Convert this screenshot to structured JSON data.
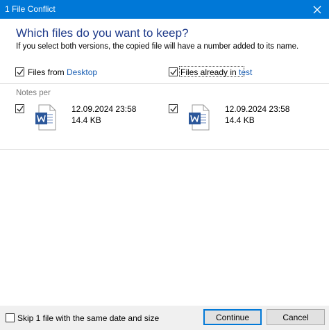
{
  "window": {
    "title": "1 File Conflict",
    "close_icon": "close-icon"
  },
  "header": {
    "heading": "Which files do you want to keep?",
    "subheading": "If you select both versions, the copied file will have a number added to its name."
  },
  "columns": {
    "left": {
      "prefix": "Files from ",
      "source": "Desktop",
      "checked": true
    },
    "right": {
      "prefix": "Files already in ",
      "source": "test",
      "checked": true
    }
  },
  "group": {
    "label": "Notes per"
  },
  "files": [
    {
      "icon": "word-document-icon",
      "date": "12.09.2024 23:58",
      "size": "14.4 KB",
      "checked": true
    },
    {
      "icon": "word-document-icon",
      "date": "12.09.2024 23:58",
      "size": "14.4 KB",
      "checked": true
    }
  ],
  "footer": {
    "skip_label": "Skip 1 file with the same date and size",
    "skip_checked": false,
    "continue_label": "Continue",
    "cancel_label": "Cancel"
  },
  "colors": {
    "accent": "#0078d7",
    "heading": "#1f3b8a",
    "link": "#1a5fb4",
    "word_blue": "#2b579a"
  }
}
